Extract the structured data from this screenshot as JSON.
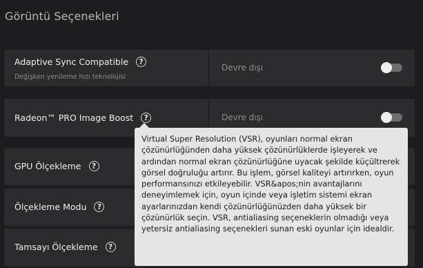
{
  "page_title": "Görüntü Seçenekleri",
  "settings": [
    {
      "label": "Adaptive Sync Compatible",
      "sublabel": "Değişken yenileme hızı teknolojisi",
      "value": "Devre dışı",
      "toggle_on": false
    },
    {
      "label": "Radeon™ PRO Image Boost",
      "value": "Devre dışı",
      "toggle_on": false
    },
    {
      "label": "GPU Ölçekleme"
    },
    {
      "label": "Ölçekleme Modu"
    },
    {
      "label": "Tamsayı Ölçekleme"
    }
  ],
  "tooltip": {
    "text": "Virtual Super Resolution (VSR), oyunları normal ekran çözünürlüğünden daha yüksek çözünürlüklerde işleyerek ve ardından normal ekran çözünürlüğüne uyacak şekilde küçültrerek görsel doğruluğu artırır.  Bu işlem, görsel kaliteyi artırırken, oyun performansınızı etkileyebilir. VSR&apos;nin avantajlarını deneyimlemek için, oyun içinde veya işletim sistemi ekran ayarlarınızdan kendi çözünürlüğünüzden daha yüksek bir çözünürlük seçin. VSR, antialiasing seçeneklerin olmadığı veya yetersiz antialiasing seçenekleri sunan eski oyunlar için idealdir."
  },
  "icons": {
    "help": "help-circle-icon",
    "chevron": "chevron-right-icon",
    "help_glyph": "?",
    "chevron_glyph": "›"
  },
  "colors": {
    "background": "#1d1d1f",
    "row": "#2b2b2d",
    "tooltip": "#e5e5e5",
    "toggle_off": "#6e6e70"
  }
}
